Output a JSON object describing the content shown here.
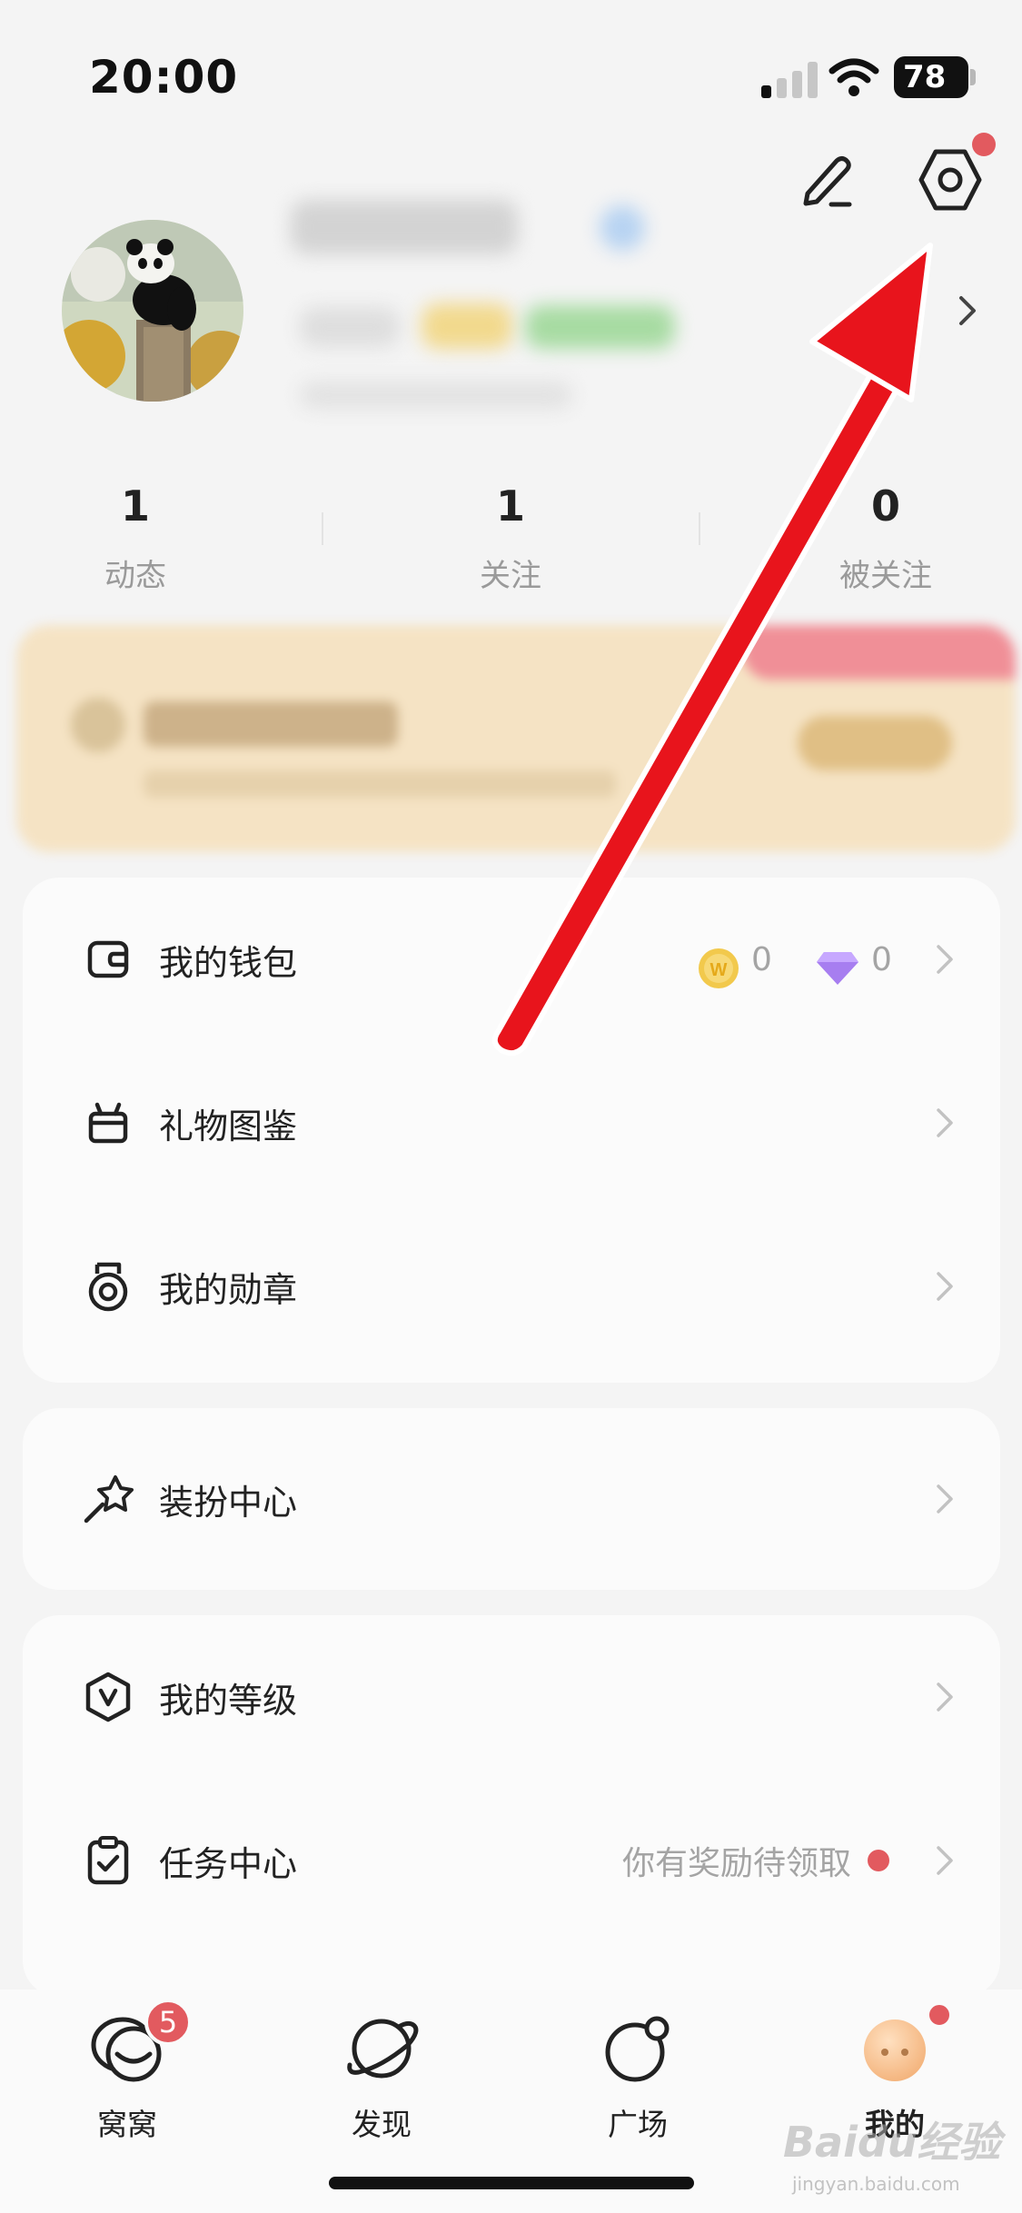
{
  "status_bar": {
    "time": "20:00",
    "battery": "78"
  },
  "header": {
    "edit_icon": "pencil-icon",
    "settings_icon": "hexagon-gear-icon",
    "settings_has_notification": true
  },
  "profile": {
    "avatar": "panda-avatar",
    "username": "",
    "stats": [
      {
        "value": "1",
        "label": "动态"
      },
      {
        "value": "1",
        "label": "关注"
      },
      {
        "value": "0",
        "label": "被关注"
      }
    ]
  },
  "card1": {
    "rows": [
      {
        "label": "我的钱包",
        "icon": "wallet-icon",
        "coins": "0",
        "diamonds": "0"
      },
      {
        "label": "礼物图鉴",
        "icon": "gift-icon"
      },
      {
        "label": "我的勋章",
        "icon": "medal-icon"
      }
    ]
  },
  "card2": {
    "rows": [
      {
        "label": "装扮中心",
        "icon": "wand-icon"
      }
    ]
  },
  "card3": {
    "rows": [
      {
        "label": "我的等级",
        "icon": "level-shield-icon"
      },
      {
        "label": "任务中心",
        "icon": "clipboard-check-icon",
        "hint": "你有奖励待领取"
      }
    ]
  },
  "tabbar": {
    "tabs": [
      {
        "label": "窝窝",
        "icon": "nest-icon",
        "badge": "5"
      },
      {
        "label": "发现",
        "icon": "planet-icon"
      },
      {
        "label": "广场",
        "icon": "circle-dot-icon"
      },
      {
        "label": "我的",
        "icon": "profile-face-icon",
        "active": true
      }
    ]
  },
  "watermark": {
    "text": "Baidu经验",
    "sub": "jingyan.baidu.com"
  },
  "colors": {
    "accent_red": "#e25a5f",
    "annotation_arrow": "#e8141c",
    "banner_bg": "#f5e3c4"
  }
}
